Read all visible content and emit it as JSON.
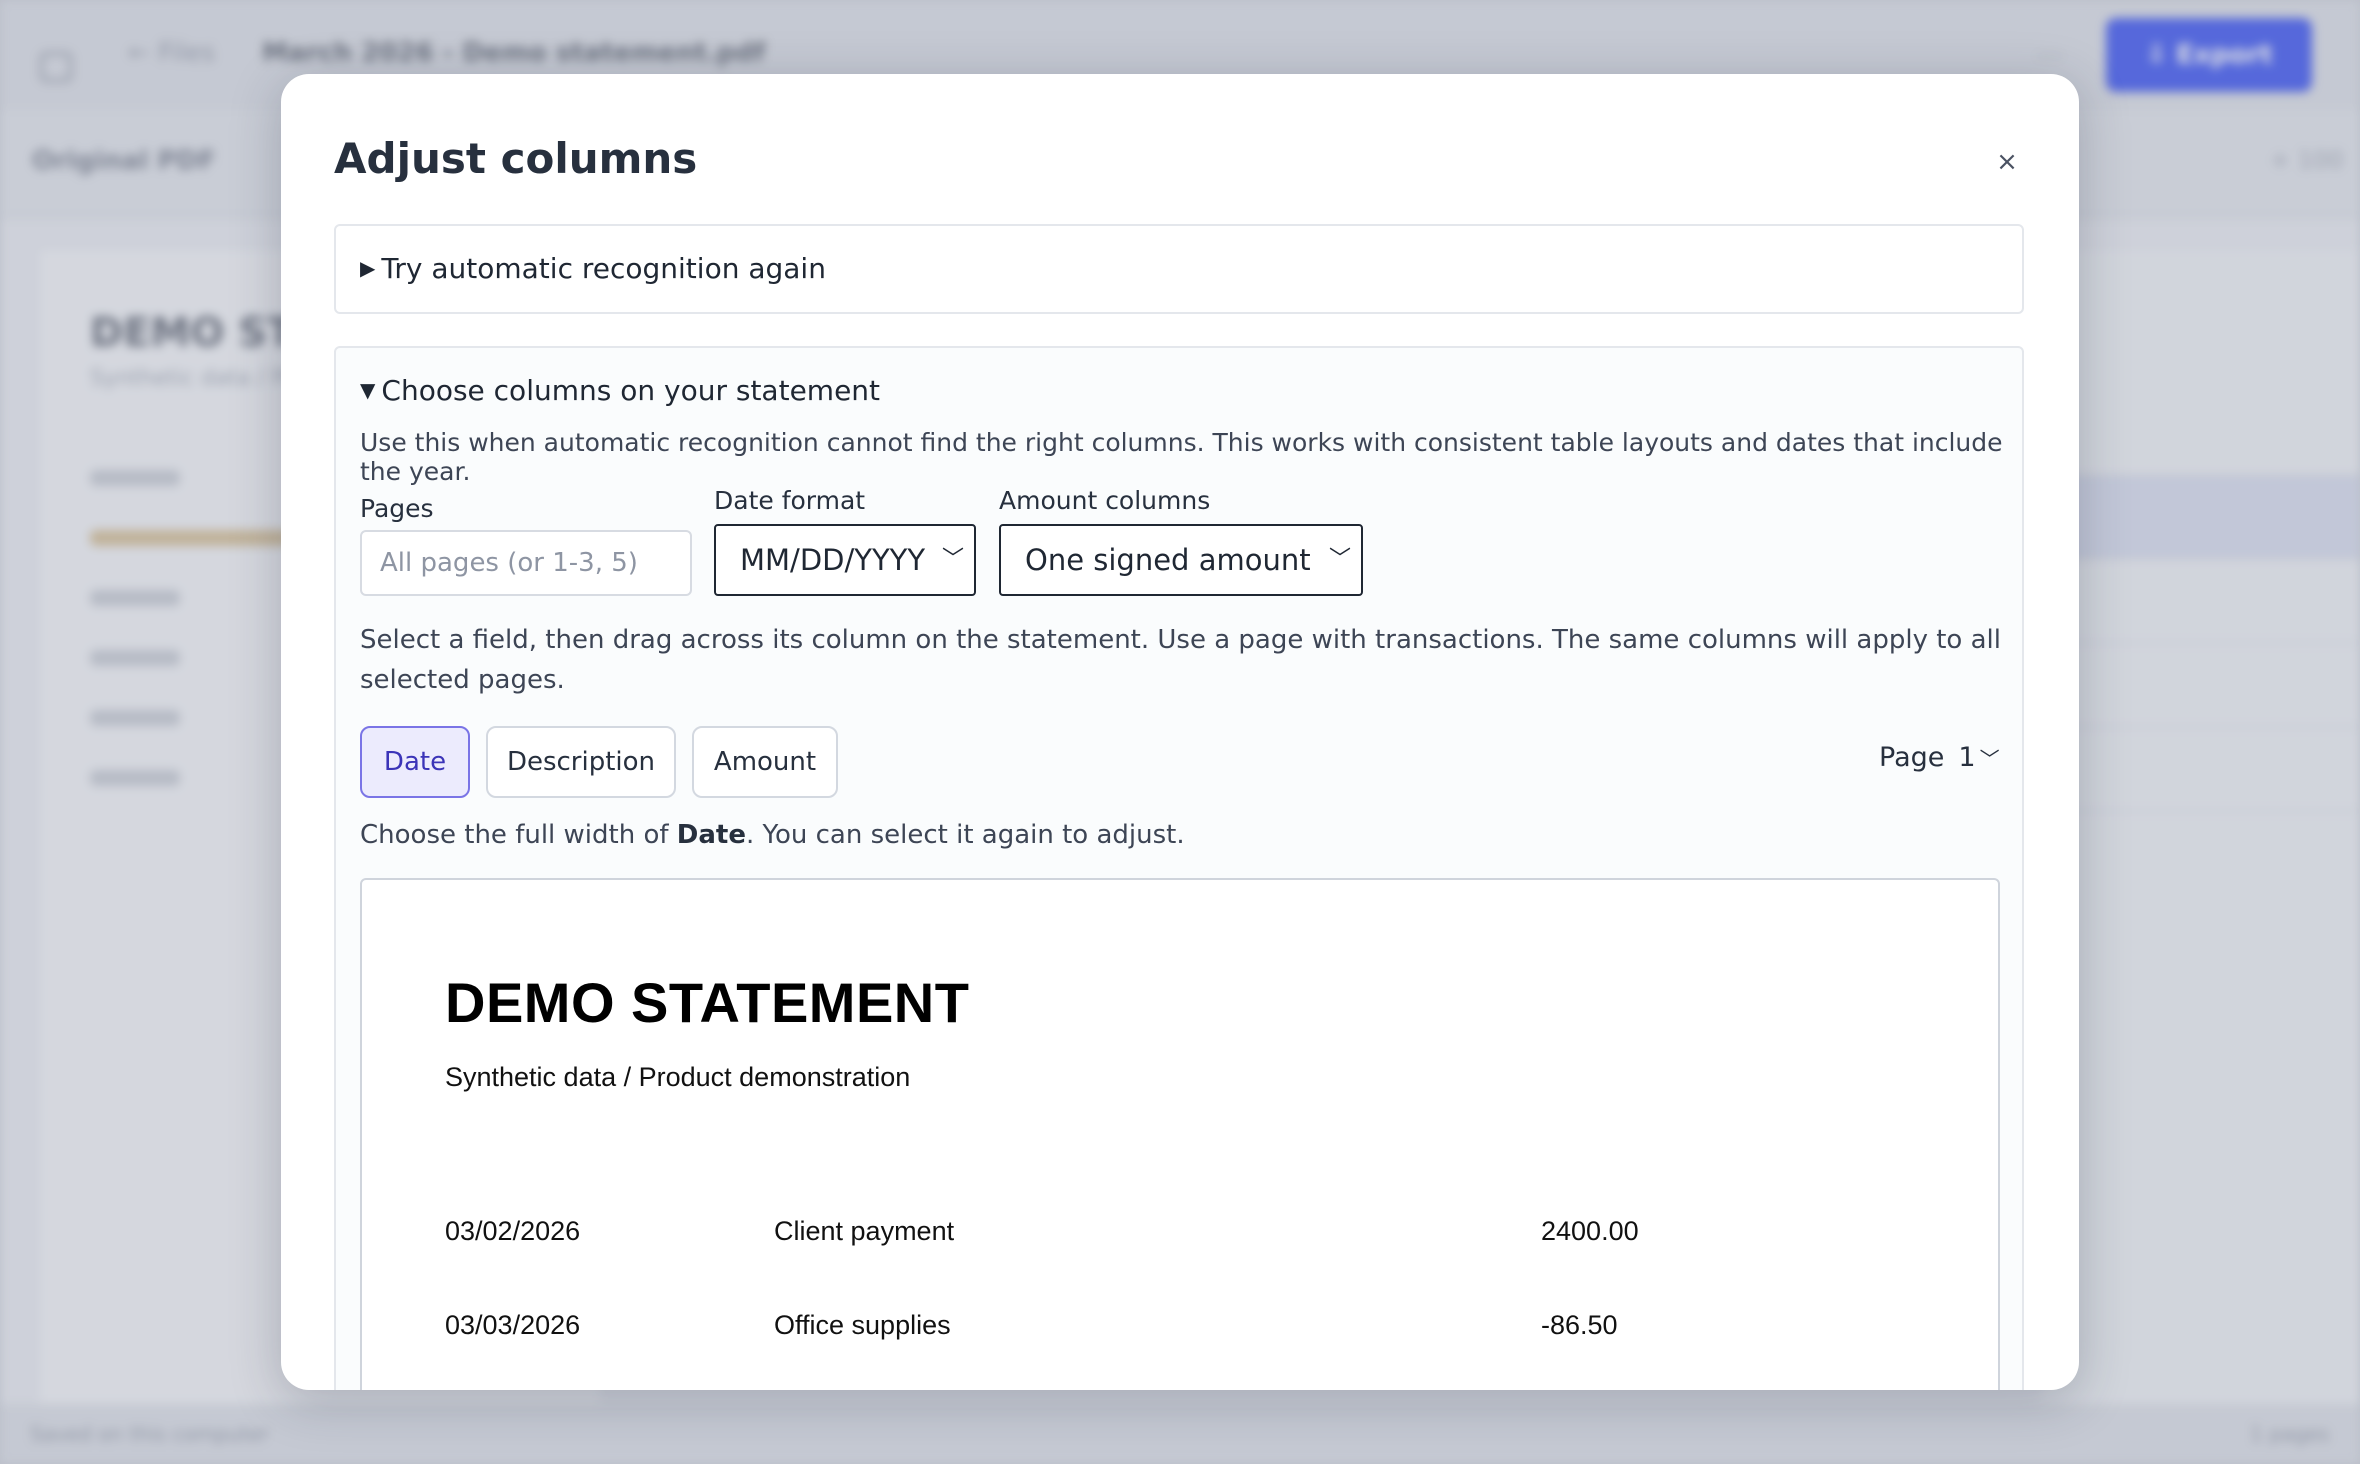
{
  "background": {
    "back_label": "Files",
    "file_title": "March 2026 - Demo statement.pdf",
    "export_label": "Export",
    "original_label": "Original PDF",
    "doc_title": "DEMO STA",
    "doc_sub": "Synthetic data / Product",
    "footer_left": "Saved on this computer",
    "footer_right": "1 pages"
  },
  "modal": {
    "title": "Adjust columns",
    "close_label": "×",
    "auto_section": {
      "summary": "Try automatic recognition again"
    },
    "manual_section": {
      "summary": "Choose columns on your statement",
      "help": "Use this when automatic recognition cannot find the right columns. This works with consistent table layouts and dates that include the year.",
      "pages": {
        "label": "Pages",
        "placeholder": "All pages (or 1-3, 5)",
        "value": ""
      },
      "date_format": {
        "label": "Date format",
        "selected": "MM/DD/YYYY"
      },
      "amount_columns": {
        "label": "Amount columns",
        "selected": "One signed amount"
      },
      "instruction": "Select a field, then drag across its column on the statement. Use a page with transactions. The same columns will apply to all selected pages.",
      "fields": [
        {
          "label": "Date",
          "active": true
        },
        {
          "label": "Description",
          "active": false
        },
        {
          "label": "Amount",
          "active": false
        }
      ],
      "page_selector": {
        "label": "Page",
        "value": "1"
      },
      "hint": {
        "prefix": "Choose the full width of ",
        "field": "Date",
        "suffix": ". You can select it again to adjust."
      }
    },
    "preview": {
      "title": "DEMO STATEMENT",
      "subtitle": "Synthetic data / Product demonstration",
      "rows": [
        {
          "date": "03/02/2026",
          "description": "Client payment",
          "amount": "2400.00"
        },
        {
          "date": "03/03/2026",
          "description": "Office supplies",
          "amount": "-86.50"
        }
      ]
    }
  },
  "colors": {
    "accent": "#2e48f0",
    "active_field_bg": "#ecebfd",
    "active_field_border": "#7a74e6",
    "active_field_text": "#3b34b8"
  }
}
